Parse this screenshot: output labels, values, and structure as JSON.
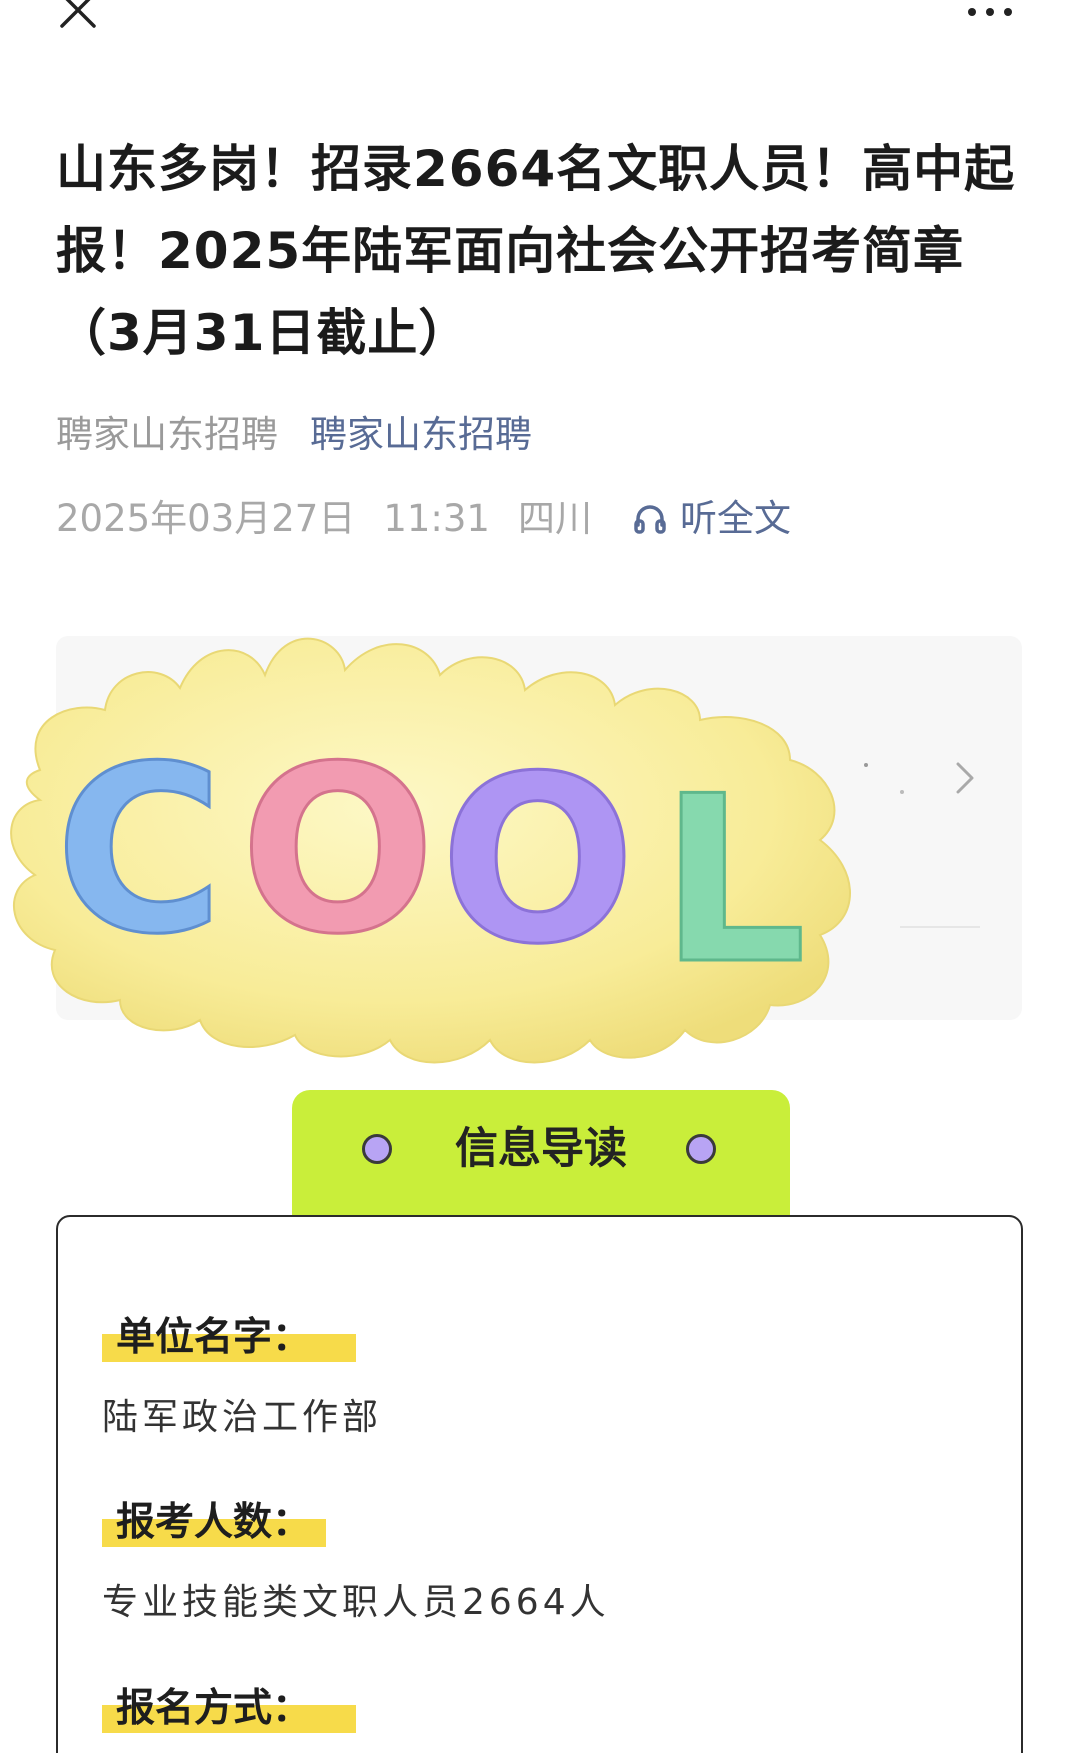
{
  "topbar": {
    "close_icon": "close-icon",
    "more_icon": "more-icon"
  },
  "article": {
    "title": "山东多岗！招录2664名文职人员！高中起报！2025年陆军面向社会公开招考简章（3月31日截止）",
    "author_name": "聘家山东招聘",
    "account_name": "聘家山东招聘",
    "date": "2025年03月27日",
    "time": "11:31",
    "region": "四川",
    "listen_label": "听全文",
    "listen_icon": "headphones-icon"
  },
  "sticker": {
    "text": "COOL",
    "colors": [
      "#7fb3f0",
      "#f08fa7",
      "#a98cf2",
      "#7fd8a9"
    ],
    "blob_color": "#f9f0a3"
  },
  "info": {
    "heading": "信息导读",
    "accent": "#c9ee3a",
    "highlight": "#f7db4a",
    "fields": [
      {
        "label": "单位名字：",
        "value": "陆军政治工作部"
      },
      {
        "label": "报考人数：",
        "value": "专业技能类文职人员2664人"
      },
      {
        "label": "报名方式：",
        "value": ""
      }
    ]
  }
}
